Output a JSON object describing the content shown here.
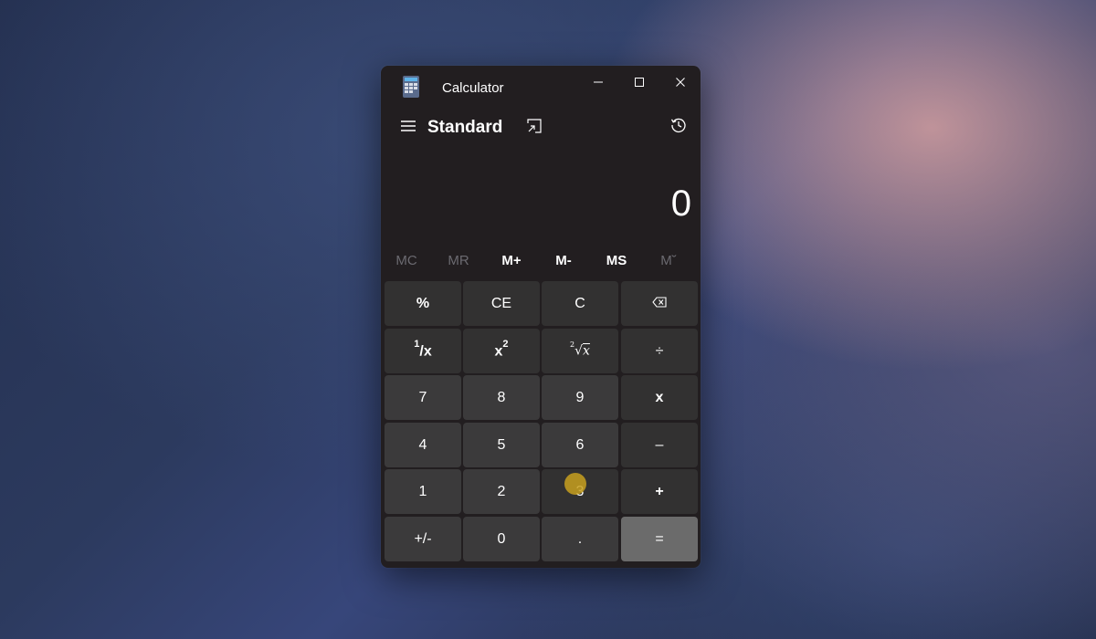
{
  "window": {
    "app_title": "Calculator",
    "mode_title": "Standard"
  },
  "display": {
    "value": "0"
  },
  "memory": {
    "mc": "MC",
    "mr": "MR",
    "m_plus": "M+",
    "m_minus": "M-",
    "ms": "MS",
    "m_list": "M˘"
  },
  "keys": {
    "percent": "%",
    "ce": "CE",
    "c": "C",
    "divide": "÷",
    "seven": "7",
    "eight": "8",
    "nine": "9",
    "multiply": "x",
    "four": "4",
    "five": "5",
    "six": "6",
    "minus": "–",
    "one": "1",
    "two": "2",
    "three": "3",
    "plus": "+",
    "negate": "+/-",
    "zero": "0",
    "decimal": ".",
    "equals": "="
  },
  "icons": {
    "app": "calculator-icon",
    "minimize": "minimize-icon",
    "maximize": "maximize-icon",
    "close": "close-icon",
    "menu": "hamburger-icon",
    "keep_on_top": "keep-on-top-icon",
    "history": "history-icon",
    "backspace": "backspace-icon"
  },
  "colors": {
    "window_bg": "#221e20",
    "number_key": "#3b3a3b",
    "operator_key": "#323131",
    "equals_key": "#6b6b6b",
    "disabled_text": "#6b6a70"
  }
}
